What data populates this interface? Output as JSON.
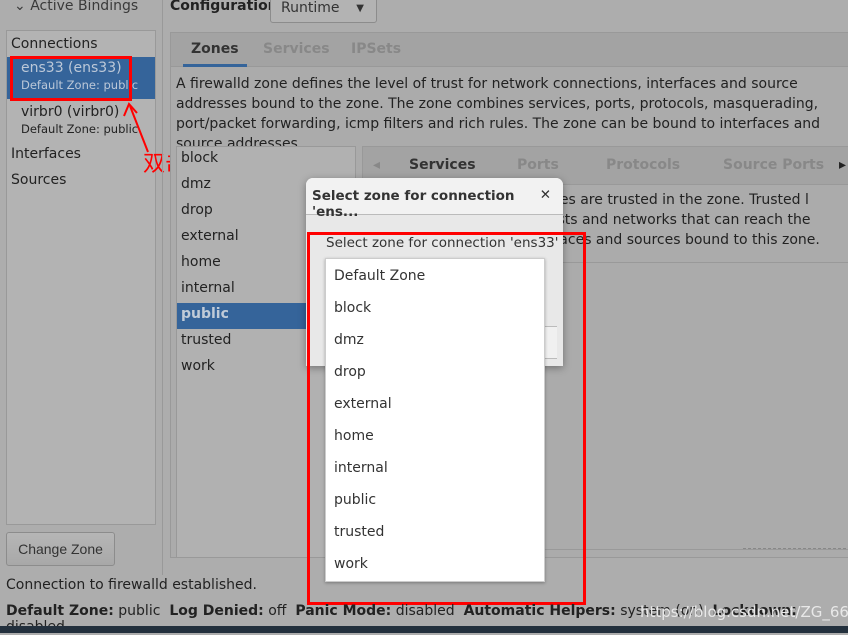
{
  "sidebar": {
    "toggle": "Active Bindings",
    "connections_header": "Connections",
    "connections": [
      {
        "name": "ens33 (ens33)",
        "zone": "Default Zone: public",
        "selected": true
      },
      {
        "name": "virbr0 (virbr0)",
        "zone": "Default Zone: public",
        "selected": false
      }
    ],
    "interfaces": "Interfaces",
    "sources": "Sources",
    "change_zone": "Change Zone"
  },
  "config": {
    "label": "Configuration:",
    "value": "Runtime"
  },
  "tabs": [
    "Zones",
    "Services",
    "IPSets"
  ],
  "zones_description": "A firewalld zone defines the level of trust for network connections, interfaces and source addresses bound to the zone. The zone combines services, ports, protocols, masquerading, port/packet forwarding, icmp filters and rich rules. The zone can be bound to interfaces and source addresses.",
  "zones": [
    "block",
    "dmz",
    "drop",
    "external",
    "home",
    "internal",
    "public",
    "trusted",
    "work"
  ],
  "selected_zone": "public",
  "subtabs": [
    "Services",
    "Ports",
    "Protocols",
    "Source Ports"
  ],
  "services_description": "vices are trusted in the zone. Trusted l hosts and networks that can reach the erfaces and sources bound to this zone.",
  "dialog": {
    "title": "Select zone for connection 'ens...",
    "label": "Select zone for connection 'ens33'",
    "options": [
      "Default Zone",
      "block",
      "dmz",
      "drop",
      "external",
      "home",
      "internal",
      "public",
      "trusted",
      "work"
    ]
  },
  "annotation": "双击",
  "status": {
    "message": "Connection to firewalld established.",
    "items": [
      {
        "k": "Default Zone:",
        "v": "public"
      },
      {
        "k": "Log Denied:",
        "v": "off"
      },
      {
        "k": "Panic Mode:",
        "v": "disabled"
      },
      {
        "k": "Automatic Helpers:",
        "v": "system (on)"
      },
      {
        "k": "Lockdown:",
        "v": "disabled"
      }
    ]
  },
  "watermark": "https://blog.csdn.net/ZG_66",
  "colors": {
    "selection": "#35649a",
    "annotation": "#ff0000"
  }
}
